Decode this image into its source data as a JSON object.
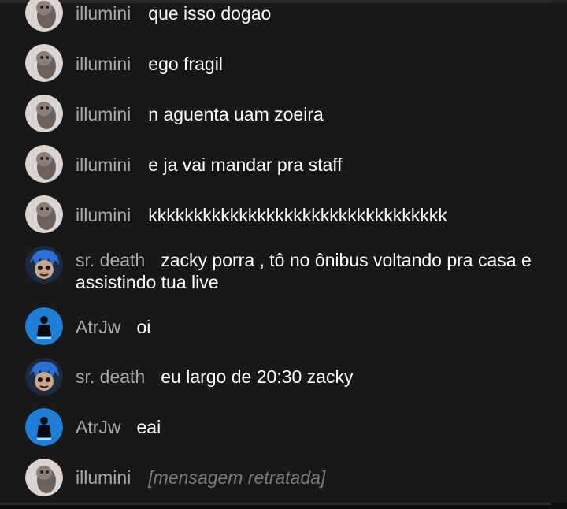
{
  "messages": [
    {
      "author": "illumini",
      "text": "que isso dogao",
      "avatar": "owl-avatar-icon",
      "retracted": false
    },
    {
      "author": "illumini",
      "text": "ego fragil",
      "avatar": "owl-avatar-icon",
      "retracted": false
    },
    {
      "author": "illumini",
      "text": "n aguenta uam zoeira",
      "avatar": "owl-avatar-icon",
      "retracted": false
    },
    {
      "author": "illumini",
      "text": "e ja vai mandar pra staff",
      "avatar": "owl-avatar-icon",
      "retracted": false
    },
    {
      "author": "illumini",
      "text": "kkkkkkkkkkkkkkkkkkkkkkkkkkkkkkkkk",
      "avatar": "owl-avatar-icon",
      "retracted": false
    },
    {
      "author": "sr. death",
      "text": "zacky porra , tô no ônibus voltando pra casa e assistindo tua live",
      "avatar": "blue-hair-character-avatar-icon",
      "retracted": false
    },
    {
      "author": "AtrJw",
      "text": "oi",
      "avatar": "blue-circle-avatar-icon",
      "retracted": false
    },
    {
      "author": "sr. death",
      "text": "eu largo de 20:30 zacky",
      "avatar": "blue-hair-character-avatar-icon",
      "retracted": false
    },
    {
      "author": "AtrJw",
      "text": "eai",
      "avatar": "blue-circle-avatar-icon",
      "retracted": false
    },
    {
      "author": "illumini",
      "text": "[mensagem retratada]",
      "avatar": "owl-avatar-icon",
      "retracted": true
    }
  ],
  "colors": {
    "background": "#181818",
    "author": "#a9a9a9",
    "message": "#ffffff",
    "retracted": "#7a7a7a"
  }
}
